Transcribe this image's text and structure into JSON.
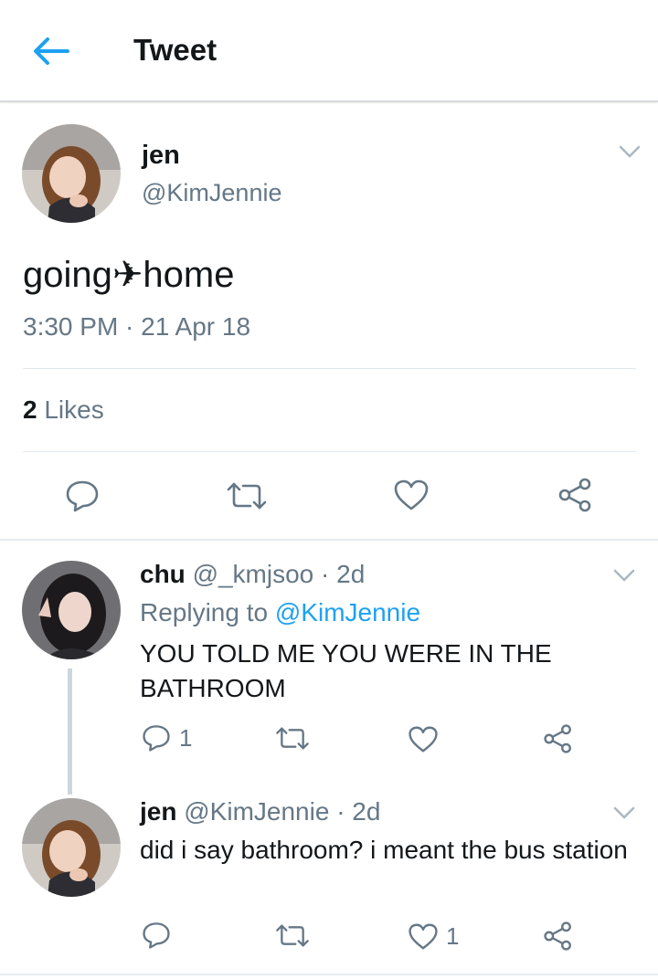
{
  "header": {
    "title": "Tweet"
  },
  "tweet": {
    "name": "jen",
    "handle": "@KimJennie",
    "text": "going✈home",
    "timestamp": "3:30 PM · 21 Apr 18",
    "likes_count": "2",
    "likes_label": "Likes"
  },
  "replies": [
    {
      "name": "chu",
      "handle": "@_kmjsoo",
      "age": "· 2d",
      "replying_prefix": "Replying to",
      "replying_to": "@KimJennie",
      "text": "YOU TOLD ME YOU WERE IN THE BATHROOM",
      "reply_count": "1",
      "like_count": ""
    },
    {
      "name": "jen",
      "handle": "@KimJennie",
      "age": "· 2d",
      "text": "did i say bathroom? i meant the bus station",
      "reply_count": "",
      "like_count": "1"
    }
  ],
  "colors": {
    "accent": "#1da1f2",
    "icon_gray": "#657786",
    "divider": "#e1e8ed"
  },
  "icons": [
    "back-arrow-icon",
    "chevron-down-icon",
    "reply-icon",
    "retweet-icon",
    "heart-icon",
    "share-icon"
  ]
}
